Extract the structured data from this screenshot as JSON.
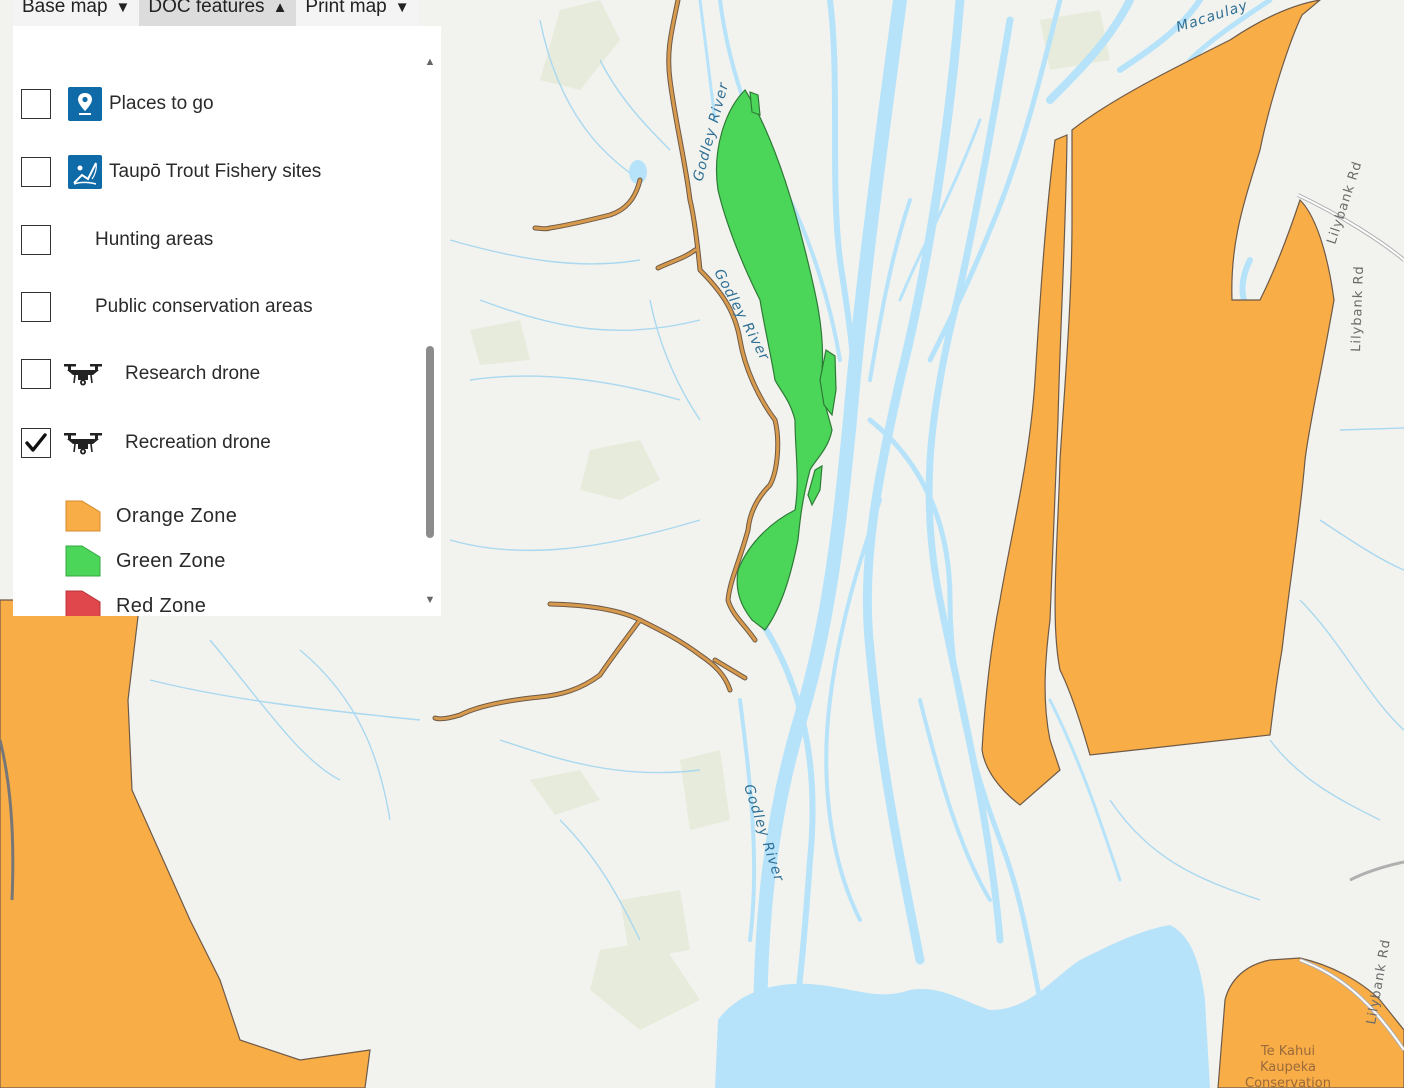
{
  "menu": {
    "base_map": "Base map",
    "doc_features": "DOC features",
    "print_map": "Print map",
    "caret_down": "▼",
    "caret_up": "▲"
  },
  "layers": [
    {
      "label": "Places to go",
      "checked": false,
      "icon": "map-pin-icon"
    },
    {
      "label": "Taupō Trout Fishery sites",
      "checked": false,
      "icon": "fishing-icon"
    },
    {
      "label": "Hunting areas",
      "checked": false,
      "icon": ""
    },
    {
      "label": "Public conservation areas",
      "checked": false,
      "icon": ""
    },
    {
      "label": "Research drone",
      "checked": false,
      "icon": "drone-icon"
    },
    {
      "label": "Recreation drone",
      "checked": true,
      "icon": "drone-icon"
    }
  ],
  "legend": [
    {
      "label": "Orange Zone",
      "color": "#f9ad47"
    },
    {
      "label": "Green Zone",
      "color": "#4bd65a"
    },
    {
      "label": "Red Zone",
      "color": "#e0474c"
    }
  ],
  "map": {
    "labels": {
      "river_1": "Godley River",
      "river_2": "Godley River",
      "river_3": "Godley River",
      "river_top": "Macaulay",
      "road_1": "Lilybank Rd",
      "road_2": "Lilybank Rd",
      "road_3": "Lilybank Rd",
      "park_line1": "Te Kahui",
      "park_line2": "Kaupeka",
      "park_line3": "Conservation"
    },
    "colors": {
      "land": "#f2f3ee",
      "water": "#b7e3fa",
      "orange_zone": "#f9ad47",
      "green_zone": "#4bd65a",
      "track": "#c98a3c"
    }
  }
}
